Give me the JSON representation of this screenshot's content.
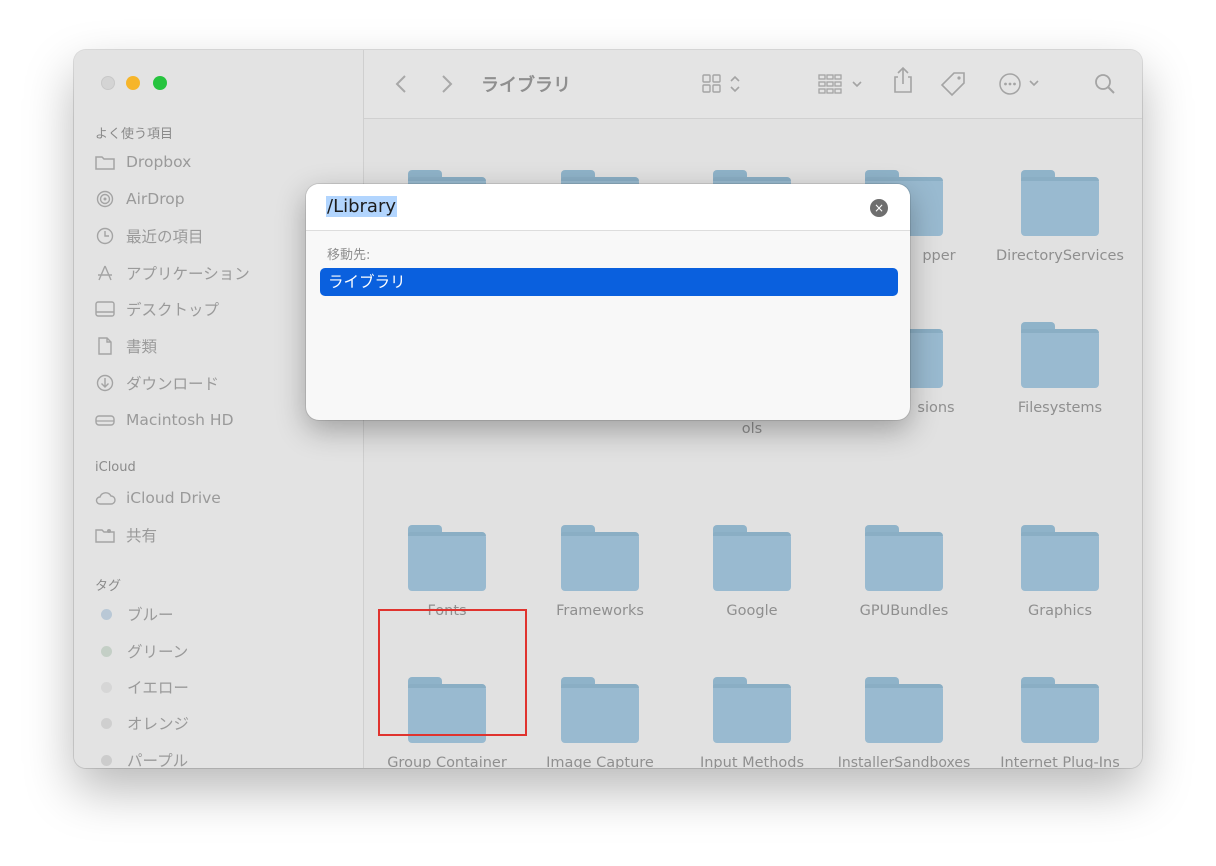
{
  "window": {
    "title": "ライブラリ"
  },
  "sidebar": {
    "sections": [
      {
        "header": "よく使う項目",
        "items": [
          {
            "label": "Dropbox",
            "icon": "folder-icon"
          },
          {
            "label": "AirDrop",
            "icon": "airdrop-icon"
          },
          {
            "label": "最近の項目",
            "icon": "clock-icon"
          },
          {
            "label": "アプリケーション",
            "icon": "applications-icon"
          },
          {
            "label": "デスクトップ",
            "icon": "desktop-icon"
          },
          {
            "label": "書類",
            "icon": "document-icon"
          },
          {
            "label": "ダウンロード",
            "icon": "download-icon"
          },
          {
            "label": "Macintosh HD",
            "icon": "disk-icon"
          }
        ]
      },
      {
        "header": "iCloud",
        "items": [
          {
            "label": "iCloud Drive",
            "icon": "cloud-icon"
          },
          {
            "label": "共有",
            "icon": "shared-folder-icon"
          }
        ]
      },
      {
        "header": "タグ",
        "items": [
          {
            "label": "ブルー",
            "icon": "tag-dot-icon"
          },
          {
            "label": "グリーン",
            "icon": "tag-dot-icon"
          },
          {
            "label": "イエロー",
            "icon": "tag-dot-icon"
          },
          {
            "label": "オレンジ",
            "icon": "tag-dot-icon"
          },
          {
            "label": "パープル",
            "icon": "tag-dot-icon"
          }
        ]
      }
    ]
  },
  "content": {
    "rows": [
      [
        "",
        "",
        "",
        "pper",
        "DirectoryServices"
      ],
      [
        "",
        "",
        "ols",
        "sions",
        "Filesystems"
      ],
      [
        "Fonts",
        "Frameworks",
        "Google",
        "GPUBundles",
        "Graphics"
      ],
      [
        "Group Container",
        "Image Capture",
        "Input Methods",
        "InstallerSandboxes",
        "Internet Plug-Ins"
      ]
    ]
  },
  "dialog": {
    "path_value": "/Library",
    "destination_label": "移動先:",
    "suggestions": [
      "ライブラリ"
    ],
    "clear_icon": "×"
  },
  "colors": {
    "accent": "#0a60de",
    "highlight_box": "#e0332e",
    "folder": "#99bad0"
  }
}
